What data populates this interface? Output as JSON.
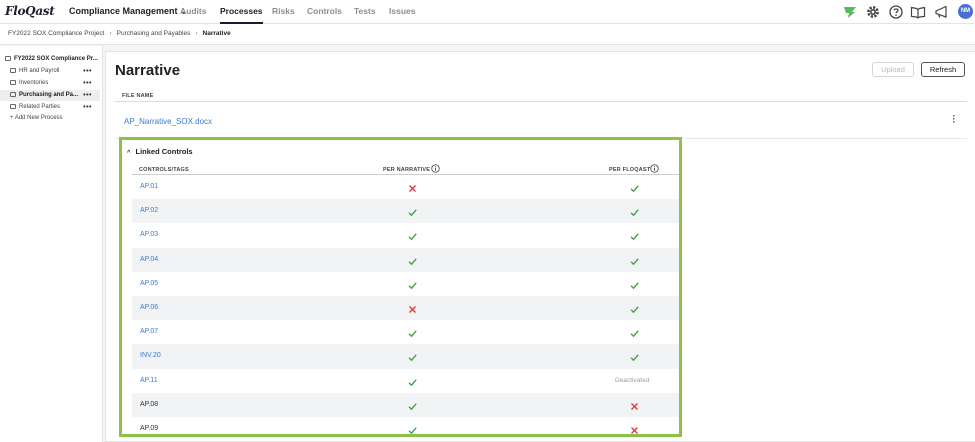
{
  "app": {
    "logo": "FloQast",
    "product": "Compliance Management",
    "nav": [
      {
        "label": "Audits",
        "active": false
      },
      {
        "label": "Processes",
        "active": true
      },
      {
        "label": "Risks",
        "active": false
      },
      {
        "label": "Controls",
        "active": false
      },
      {
        "label": "Tests",
        "active": false
      },
      {
        "label": "Issues",
        "active": false
      }
    ],
    "icons": [
      "floqast-logo-icon",
      "gear-icon",
      "help-icon",
      "book-icon",
      "announcement-icon"
    ],
    "avatar_initials": "NM",
    "colors": {
      "link": "#3a7bd5",
      "check": "#43a047",
      "cross": "#e53935",
      "highlight": "#8bc34a",
      "avatar": "#4a6fd0",
      "floqast_green": "#5cb85c"
    }
  },
  "breadcrumb": {
    "items": [
      "FY2022 SOX Compliance Project",
      "Purchasing and Payables"
    ],
    "current": "Narrative"
  },
  "sidebar": {
    "root": "FY2022 SOX Compliance Pr...",
    "items": [
      {
        "label": "HR and Payroll",
        "selected": false
      },
      {
        "label": "Inventories",
        "selected": false
      },
      {
        "label": "Purchasing and Pa...",
        "selected": true
      },
      {
        "label": "Related Parties",
        "selected": false
      }
    ],
    "add_label": "+  Add New Process"
  },
  "main": {
    "title": "Narrative",
    "upload_label": "Upload",
    "refresh_label": "Refresh",
    "file_name_header": "FILE NAME",
    "file_name": "AP_Narrative_SOX.docx",
    "linked_controls": {
      "title": "Linked Controls",
      "col_controls": "CONTROLS/TAGS",
      "col_narrative": "PER NARRATIVE",
      "col_floqast": "PER FLOQAST",
      "rows": [
        {
          "id": "AP.01",
          "link": true,
          "narrative": "cross",
          "floqast": "check"
        },
        {
          "id": "AP.02",
          "link": true,
          "narrative": "check",
          "floqast": "check"
        },
        {
          "id": "AP.03",
          "link": true,
          "narrative": "check",
          "floqast": "check"
        },
        {
          "id": "AP.04",
          "link": true,
          "narrative": "check",
          "floqast": "check"
        },
        {
          "id": "AP.05",
          "link": true,
          "narrative": "check",
          "floqast": "check"
        },
        {
          "id": "AP.06",
          "link": true,
          "narrative": "cross",
          "floqast": "check"
        },
        {
          "id": "AP.07",
          "link": true,
          "narrative": "check",
          "floqast": "check"
        },
        {
          "id": "INV.20",
          "link": true,
          "narrative": "check",
          "floqast": "check"
        },
        {
          "id": "AP.11",
          "link": true,
          "narrative": "check",
          "floqast": "Deactivated"
        },
        {
          "id": "AP.08",
          "link": false,
          "narrative": "check",
          "floqast": "cross"
        },
        {
          "id": "AP.09",
          "link": false,
          "narrative": "check",
          "floqast": "cross"
        }
      ]
    }
  }
}
